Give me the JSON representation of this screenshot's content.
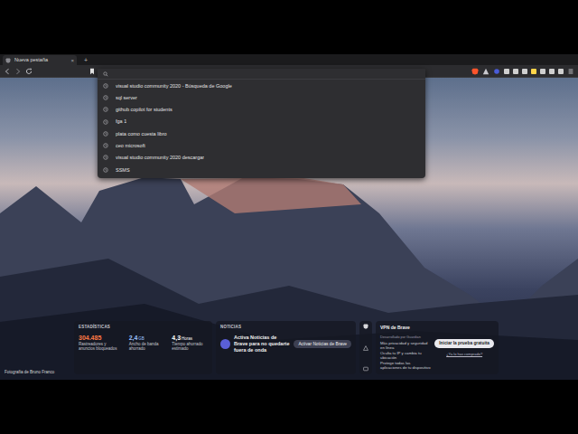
{
  "tabs": [
    {
      "label": "Nueva pestaña",
      "selected": true
    }
  ],
  "tab_close": "×",
  "new_tab_button": "+",
  "omnibox": {
    "value": "",
    "suggestions": [
      {
        "text": "visual studio community 2020 - Búsqueda de Google"
      },
      {
        "text": "sql server"
      },
      {
        "text": "github copilot for students"
      },
      {
        "text": "fga 1"
      },
      {
        "text": "plata como cuesta libro"
      },
      {
        "text": "ceo microsoft"
      },
      {
        "text": "visual studio community 2020 descargar"
      },
      {
        "text": "SSMS"
      }
    ]
  },
  "stats": {
    "title": "ESTADÍSTICAS",
    "items": [
      {
        "value": "304.485",
        "caption": "Rastreadores y anuncios bloqueados",
        "color": "#ff7a45"
      },
      {
        "value": "2,4",
        "unit": "GB",
        "caption": "Ancho de banda ahorrado",
        "color": "#9cc2ff"
      },
      {
        "value": "4,3",
        "unit": "Horas",
        "caption": "Tiempo ahorrado estimado",
        "color": "#ffffff"
      }
    ]
  },
  "news": {
    "title": "NOTICIAS",
    "text": "Activa Noticias de Brave para no quedarte fuera de onda",
    "button": "Activar Noticias de Brave"
  },
  "vpn": {
    "title": "VPN de Brave",
    "subtitle": "Desarrollado por Guardian",
    "features": [
      "Más privacidad y seguridad en línea",
      "Oculta tu IP y cambia tu ubicación",
      "Protege todas las aplicaciones de tu dispositivo"
    ],
    "button": "Iniciar la prueba gratuita",
    "link": "¿Ya lo has comprado?"
  },
  "photo_credit": "Fotografía de Bruno Franco"
}
